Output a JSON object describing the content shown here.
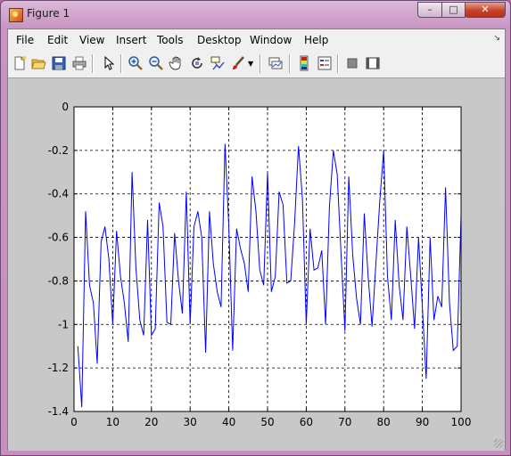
{
  "window": {
    "title": "Figure 1",
    "min_glyph": "–",
    "max_glyph": "□",
    "close_glyph": "✕"
  },
  "menu": [
    "File",
    "Edit",
    "View",
    "Insert",
    "Tools",
    "Desktop",
    "Window",
    "Help"
  ],
  "menu_dock_glyph": "↘",
  "toolbar": [
    {
      "name": "new-figure-icon"
    },
    {
      "name": "open-file-icon"
    },
    {
      "name": "save-icon"
    },
    {
      "name": "print-icon"
    },
    {
      "sep": true
    },
    {
      "name": "edit-plot-arrow-icon"
    },
    {
      "sep": true
    },
    {
      "name": "zoom-in-icon"
    },
    {
      "name": "zoom-out-icon"
    },
    {
      "name": "pan-hand-icon"
    },
    {
      "name": "rotate-3d-icon"
    },
    {
      "name": "data-cursor-icon"
    },
    {
      "name": "brush-icon"
    },
    {
      "name": "brush-dropdown-icon"
    },
    {
      "sep": true
    },
    {
      "name": "link-plot-icon"
    },
    {
      "sep": true
    },
    {
      "name": "colorbar-icon"
    },
    {
      "name": "legend-icon"
    },
    {
      "sep": true
    },
    {
      "name": "hide-plot-tools-icon"
    },
    {
      "name": "show-plot-tools-icon"
    }
  ],
  "colors": {
    "line": "#0000ff",
    "axes_bg": "#ffffff",
    "figure_bg": "#c8c8c8"
  },
  "chart_data": {
    "type": "line",
    "xlim": [
      0,
      100
    ],
    "ylim": [
      -1.4,
      0
    ],
    "xticks": [
      "0",
      "10",
      "20",
      "30",
      "40",
      "50",
      "60",
      "70",
      "80",
      "90",
      "100"
    ],
    "yticks": [
      "0",
      "-0.2",
      "-0.4",
      "-0.6",
      "-0.8",
      "-1",
      "-1.2",
      "-1.4"
    ],
    "grid": true,
    "series": [
      {
        "x": [
          1,
          2,
          3,
          4,
          5,
          6,
          7,
          8,
          9,
          10,
          11,
          12,
          13,
          14,
          15,
          16,
          17,
          18,
          19,
          20,
          21,
          22,
          23,
          24,
          25,
          26,
          27,
          28,
          29,
          30,
          31,
          32,
          33,
          34,
          35,
          36,
          37,
          38,
          39,
          40,
          41,
          42,
          43,
          44,
          45,
          46,
          47,
          48,
          49,
          50,
          51,
          52,
          53,
          54,
          55,
          56,
          57,
          58,
          59,
          60,
          61,
          62,
          63,
          64,
          65,
          66,
          67,
          68,
          69,
          70,
          71,
          72,
          73,
          74,
          75,
          76,
          77,
          78,
          79,
          80,
          81,
          82,
          83,
          84,
          85,
          86,
          87,
          88,
          89,
          90,
          91,
          92,
          93,
          94,
          95,
          96,
          97,
          98,
          99,
          100
        ],
        "y": [
          -1.1,
          -1.38,
          -0.48,
          -0.82,
          -0.9,
          -1.18,
          -0.62,
          -0.55,
          -0.7,
          -1.0,
          -0.57,
          -0.78,
          -0.9,
          -1.08,
          -0.3,
          -0.74,
          -0.98,
          -1.05,
          -0.52,
          -1.05,
          -1.02,
          -0.44,
          -0.55,
          -0.99,
          -1.0,
          -0.58,
          -0.8,
          -0.95,
          -0.39,
          -1.0,
          -0.55,
          -0.48,
          -0.6,
          -1.13,
          -0.48,
          -0.72,
          -0.85,
          -0.92,
          -0.17,
          -0.55,
          -1.12,
          -0.56,
          -0.65,
          -0.72,
          -0.85,
          -0.32,
          -0.48,
          -0.75,
          -0.82,
          -0.3,
          -0.85,
          -0.78,
          -0.39,
          -0.45,
          -0.81,
          -0.8,
          -0.53,
          -0.18,
          -0.42,
          -1.0,
          -0.56,
          -0.75,
          -0.74,
          -0.66,
          -1.0,
          -0.46,
          -0.2,
          -0.31,
          -0.68,
          -1.03,
          -0.32,
          -0.68,
          -0.88,
          -1.0,
          -0.49,
          -0.78,
          -1.01,
          -0.72,
          -0.43,
          -0.2,
          -0.78,
          -0.98,
          -0.52,
          -0.82,
          -0.98,
          -0.55,
          -0.78,
          -1.02,
          -0.6,
          -0.92,
          -1.25,
          -0.6,
          -0.98,
          -0.87,
          -0.92,
          -0.37,
          -0.9,
          -1.12,
          -1.1,
          -0.5
        ]
      }
    ]
  }
}
